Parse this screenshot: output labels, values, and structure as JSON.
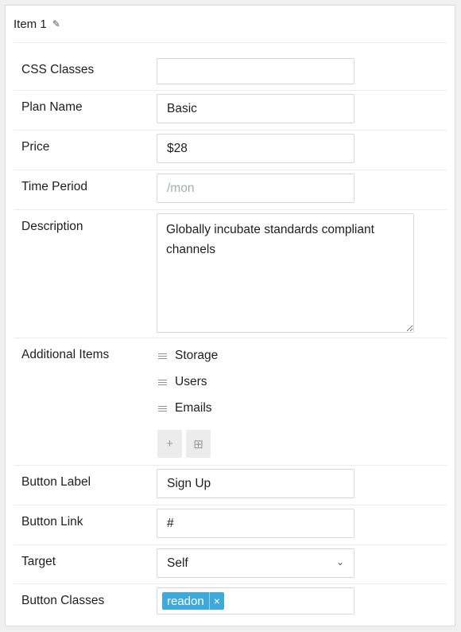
{
  "panel": {
    "title": "Item 1",
    "edit_icon": "pencil-icon"
  },
  "fields": {
    "css_classes": {
      "label": "CSS Classes",
      "value": ""
    },
    "plan_name": {
      "label": "Plan Name",
      "value": "Basic"
    },
    "price": {
      "label": "Price",
      "value": "$28"
    },
    "time_period": {
      "label": "Time Period",
      "value": "",
      "placeholder": "/mon"
    },
    "description": {
      "label": "Description",
      "value": "Globally incubate standards compliant channels"
    },
    "additional_items": {
      "label": "Additional Items",
      "items": [
        "Storage",
        "Users",
        "Emails"
      ],
      "add_icon": "plus-icon",
      "bulk_icon": "grid-icon"
    },
    "button_label": {
      "label": "Button Label",
      "value": "Sign Up"
    },
    "button_link": {
      "label": "Button Link",
      "value": "#"
    },
    "target": {
      "label": "Target",
      "value": "Self"
    },
    "button_classes": {
      "label": "Button Classes",
      "tags": [
        "readon"
      ]
    }
  },
  "colors": {
    "tag_bg": "#3fa9da",
    "border": "#d8d8d8",
    "divider": "#ececec"
  }
}
